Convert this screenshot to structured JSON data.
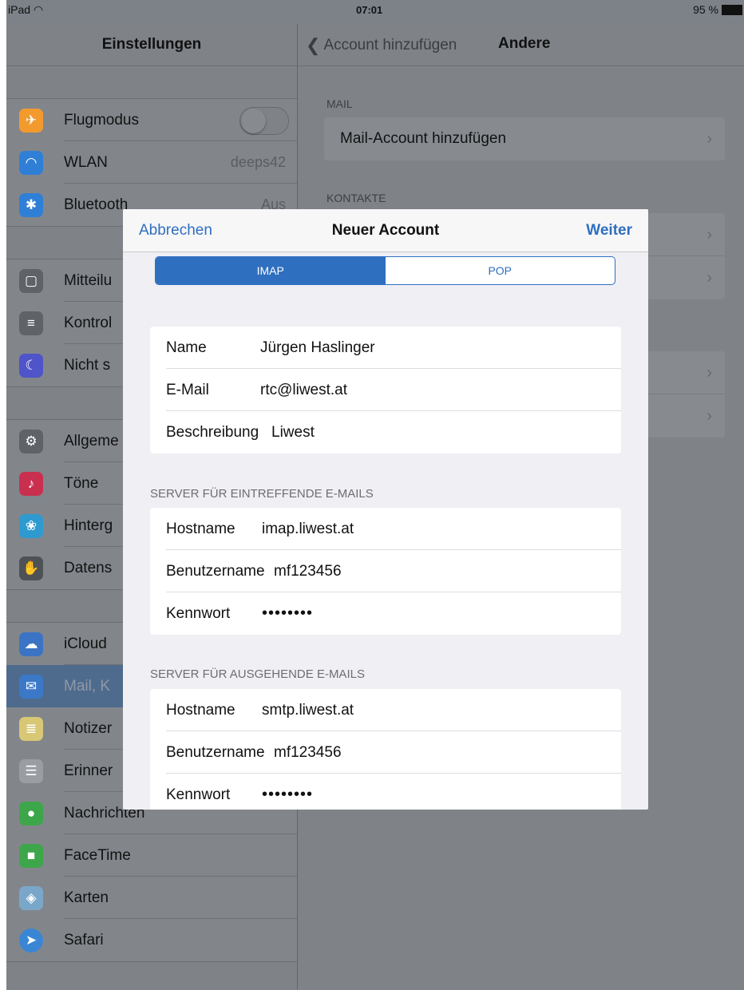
{
  "status_bar": {
    "device": "iPad",
    "time": "07:01",
    "battery": "95 %"
  },
  "sidebar": {
    "title": "Einstellungen",
    "groups": [
      [
        {
          "label": "Flugmodus",
          "icon": "airplane-icon",
          "color": "#f29a2e",
          "toggle": true
        },
        {
          "label": "WLAN",
          "icon": "wifi-icon",
          "color": "#2f7fd6",
          "value": "deeps42"
        },
        {
          "label": "Bluetooth",
          "icon": "bluetooth-icon",
          "color": "#2f7fd6",
          "value": "Aus"
        }
      ],
      [
        {
          "label": "Mitteilu",
          "icon": "notifications-icon",
          "color": "#5f6266"
        },
        {
          "label": "Kontrol",
          "icon": "control-center-icon",
          "color": "#5f6266"
        },
        {
          "label": "Nicht s",
          "icon": "moon-icon",
          "color": "#4f54c8"
        }
      ],
      [
        {
          "label": "Allgeme",
          "icon": "gear-icon",
          "color": "#5f6266"
        },
        {
          "label": "Töne",
          "icon": "speaker-icon",
          "color": "#c9304f"
        },
        {
          "label": "Hinterg",
          "icon": "wallpaper-icon",
          "color": "#2e9ad0"
        },
        {
          "label": "Datens",
          "icon": "hand-icon",
          "color": "#4e5256"
        }
      ],
      [
        {
          "label": "iCloud",
          "icon": "cloud-icon",
          "color": "#3b74c4"
        },
        {
          "label": "Mail, K",
          "icon": "mail-icon",
          "color": "#3b78c8",
          "selected": true
        },
        {
          "label": "Notizer",
          "icon": "notes-icon",
          "color": "#d8c774"
        },
        {
          "label": "Erinner",
          "icon": "reminders-icon",
          "color": "#9a9ea3"
        },
        {
          "label": "Nachrichten",
          "icon": "messages-icon",
          "color": "#3ea64a"
        },
        {
          "label": "FaceTime",
          "icon": "facetime-icon",
          "color": "#3ea64a"
        },
        {
          "label": "Karten",
          "icon": "maps-icon",
          "color": "#7aa7c9"
        },
        {
          "label": "Safari",
          "icon": "safari-icon",
          "color": "#3a86d4"
        }
      ]
    ]
  },
  "detail": {
    "back_label": "Account hinzufügen",
    "title": "Andere",
    "mail_section": "MAIL",
    "mail_row": "Mail-Account hinzufügen",
    "contacts_section": "KONTAKTE"
  },
  "modal": {
    "cancel": "Abbrechen",
    "title": "Neuer Account",
    "next": "Weiter",
    "segments": [
      "IMAP",
      "POP"
    ],
    "account": [
      {
        "key": "Name",
        "value": "Jürgen Haslinger"
      },
      {
        "key": "E-Mail",
        "value": "rtc@liwest.at"
      },
      {
        "key": "Beschreibung",
        "value": "Liwest"
      }
    ],
    "incoming_header": "SERVER FÜR EINTREFFENDE E-MAILS",
    "incoming": [
      {
        "key": "Hostname",
        "value": "imap.liwest.at"
      },
      {
        "key": "Benutzername",
        "value": "mf123456"
      },
      {
        "key": "Kennwort",
        "value": "••••••••"
      }
    ],
    "outgoing_header": "SERVER FÜR AUSGEHENDE E-MAILS",
    "outgoing": [
      {
        "key": "Hostname",
        "value": "smtp.liwest.at"
      },
      {
        "key": "Benutzername",
        "value": "mf123456"
      },
      {
        "key": "Kennwort",
        "value": "••••••••"
      }
    ]
  },
  "colors": {
    "accent": "#2f6fbf",
    "dim_background": "#7f8388"
  }
}
